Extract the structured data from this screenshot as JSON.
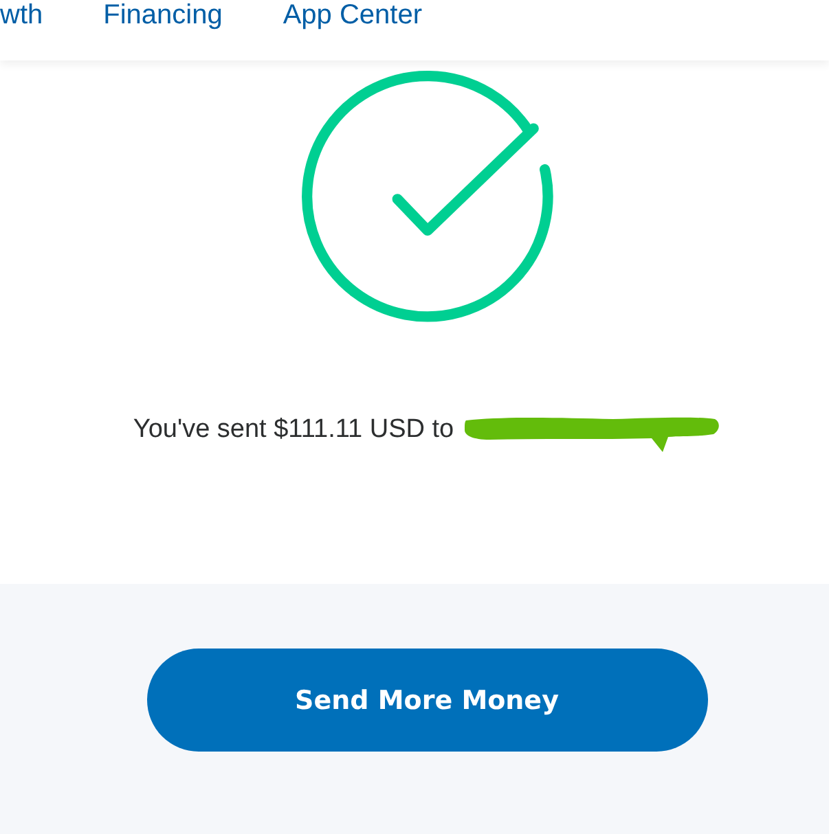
{
  "nav": {
    "items": [
      {
        "label": "wth"
      },
      {
        "label": "Financing"
      },
      {
        "label": "App Center"
      }
    ]
  },
  "confirmation": {
    "message": "You've sent $111.11 USD to"
  },
  "actions": {
    "primary_button": "Send More Money"
  }
}
